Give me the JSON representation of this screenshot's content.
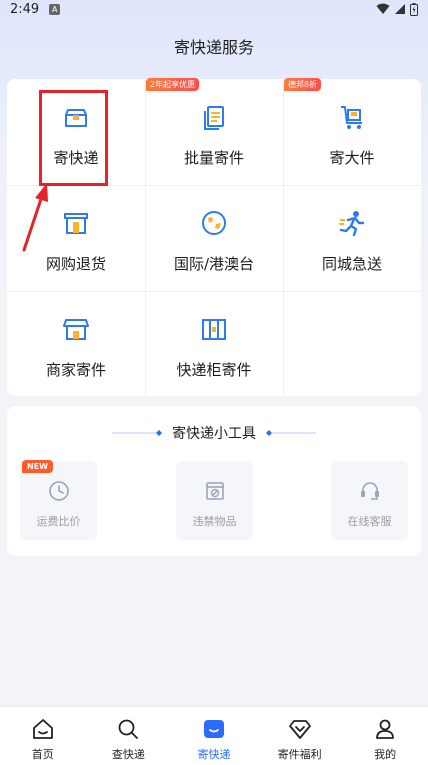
{
  "status_bar": {
    "time": "2:49",
    "app_glyph": "A",
    "icons": [
      "wifi-icon",
      "signal-icon",
      "battery-icon"
    ]
  },
  "page": {
    "title": "寄快递服务"
  },
  "services": [
    {
      "label": "寄快递",
      "icon": "box-icon"
    },
    {
      "label": "批量寄件",
      "icon": "documents-icon",
      "badge": "2年起享优惠"
    },
    {
      "label": "寄大件",
      "icon": "cart-icon",
      "badge": "德邦8折"
    },
    {
      "label": "网购退货",
      "icon": "store-return-icon"
    },
    {
      "label": "国际/港澳台",
      "icon": "globe-icon"
    },
    {
      "label": "同城急送",
      "icon": "runner-icon"
    },
    {
      "label": "商家寄件",
      "icon": "shop-icon"
    },
    {
      "label": "快递柜寄件",
      "icon": "locker-icon"
    }
  ],
  "tools": {
    "title": "寄快递小工具",
    "items": [
      {
        "label": "运费比价",
        "icon": "clock-icon",
        "badge": "NEW"
      },
      {
        "label": "违禁物品",
        "icon": "forbidden-box-icon"
      },
      {
        "label": "在线客服",
        "icon": "headset-icon"
      }
    ]
  },
  "bottom_nav": [
    {
      "label": "首页",
      "icon": "home-icon",
      "active": false
    },
    {
      "label": "查快递",
      "icon": "search-icon",
      "active": false
    },
    {
      "label": "寄快递",
      "icon": "send-package-icon",
      "active": true
    },
    {
      "label": "寄件福利",
      "icon": "diamond-icon",
      "active": false
    },
    {
      "label": "我的",
      "icon": "person-icon",
      "active": false
    }
  ],
  "colors": {
    "accent": "#2b6bff",
    "highlight": "#e4232a",
    "badge": "#ff5a2a"
  }
}
